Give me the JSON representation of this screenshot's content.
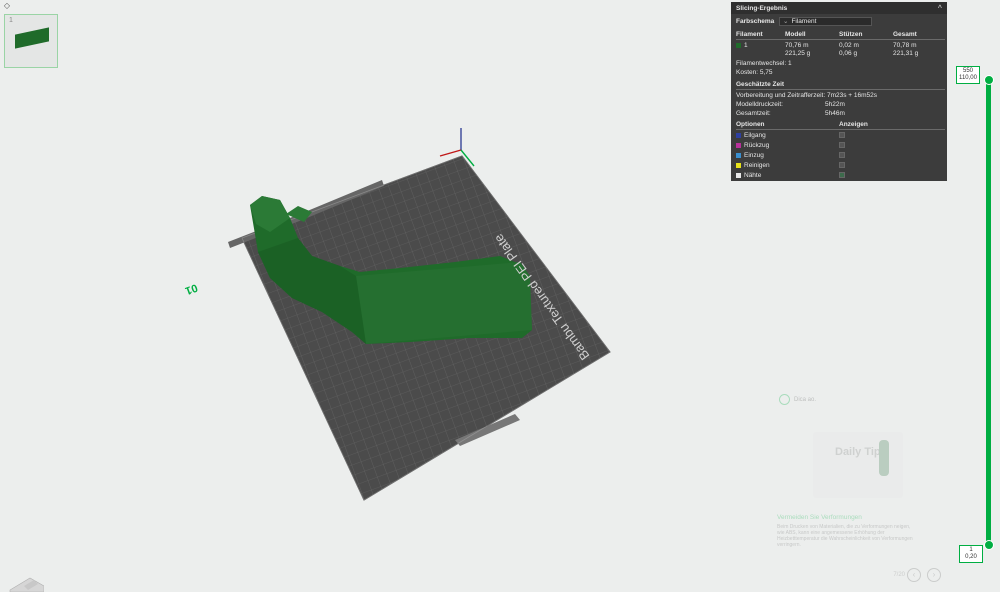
{
  "plate": {
    "number": "1"
  },
  "bed_text": {
    "brand": "Bambu Textured PEI Plate",
    "corner_number": "01"
  },
  "slicing_panel": {
    "title": "Slicing-Ergebnis",
    "color_scheme_label": "Farbschema",
    "color_scheme_value": "Filament",
    "columns": {
      "filament": "Filament",
      "model": "Modell",
      "supports": "Stützen",
      "total": "Gesamt"
    },
    "filament_row": {
      "id": "1",
      "color": "#1f6b2a",
      "model_length": "70,76 m",
      "model_weight": "221,25 g",
      "support_length": "0,02 m",
      "support_weight": "0,06 g",
      "total_length": "70,78 m",
      "total_weight": "221,31 g"
    },
    "filament_changes_label": "Filamentwechsel:",
    "filament_changes_value": "1",
    "cost_label": "Kosten:",
    "cost_value": "5,75",
    "time_section": "Geschätzte Zeit",
    "prep_label": "Vorbereitung und Zeitrafferzeit:",
    "prep_value": "7m23s + 16m52s",
    "model_time_label": "Modelldruckzeit:",
    "model_time_value": "5h22m",
    "total_time_label": "Gesamtzeit:",
    "total_time_value": "5h46m",
    "options_label": "Optionen",
    "show_label": "Anzeigen",
    "options": [
      {
        "label": "Eilgang",
        "color": "#2e3fa0",
        "checked": false
      },
      {
        "label": "Rückzug",
        "color": "#b8309a",
        "checked": false
      },
      {
        "label": "Einzug",
        "color": "#3a8fd0",
        "checked": false
      },
      {
        "label": "Reinigen",
        "color": "#e8e21a",
        "checked": false
      },
      {
        "label": "Nähte",
        "color": "#e8e8e8",
        "checked": true
      }
    ]
  },
  "layer_slider": {
    "top_layer": "550",
    "top_height": "110,00",
    "bottom_layer": "1",
    "bottom_height": "0,20",
    "color": "#00ae42"
  },
  "tips": {
    "title": "Dica ao.",
    "image_text": "Daily Tips",
    "heading": "Vermeiden Sie Verformungen",
    "body": "Beim Drucken von Materialien, die zu Verformungen neigen, wie ABS, kann eine angemessene Erhöhung der Heizbetttemperatur die Wahrscheinlichkeit von Verformungen verringern.",
    "page": "7/20"
  },
  "colors": {
    "model": "#1f6b2a",
    "bed": "#505050",
    "accent": "#00ae42",
    "panel_bg": "#3c3c3c"
  }
}
